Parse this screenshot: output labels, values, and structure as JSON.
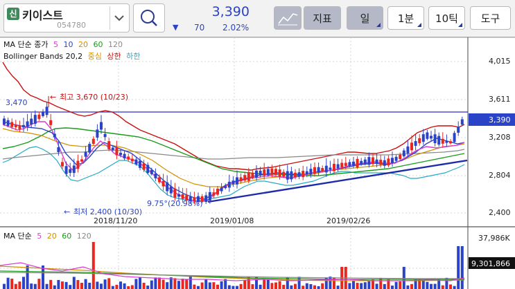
{
  "toolbar": {
    "badge": "신",
    "stock_name": "키이스트",
    "stock_code": "054780",
    "price": "3,390",
    "change_arrow": "▼",
    "change": "70",
    "change_pct": "2.02%",
    "indicator_label": "지표",
    "period_label": "일",
    "minute_label": "1분",
    "tick_label": "10틱",
    "tools_label": "도구"
  },
  "legend": {
    "ma_title": "MA 단순 종가",
    "ma_periods": [
      "5",
      "10",
      "20",
      "60",
      "120"
    ],
    "bb_title": "Bollinger Bands 20,2",
    "bb_items": [
      "중심",
      "상한",
      "하한"
    ],
    "vol_title": "MA 단순",
    "vol_periods": [
      "5",
      "20",
      "60",
      "120"
    ]
  },
  "colors": {
    "up": "#e8281e",
    "down": "#2b43c6",
    "ma5": "#d63cd0",
    "ma10": "#2b43c6",
    "ma20": "#1a9a1a",
    "ma60": "#1a9a1a",
    "ma120": "#888888",
    "bb_mid": "#d19000",
    "bb_upper": "#c80f0f",
    "bb_lower": "#25a9c4"
  },
  "axis": {
    "y_ticks": [
      "4,015",
      "3,611",
      "3,208",
      "2,804",
      "2,400"
    ],
    "x_labels": [
      "2018/11/20",
      "2019/01/08",
      "2019/02/26"
    ],
    "current_price": "3,390",
    "vol_max": "37,986K",
    "vol_current": "9,301,866"
  },
  "annotations": {
    "high_label": "최고 3,670 (10/23)",
    "low_label": "최저 2,400 (10/30)",
    "level_label": "3,470",
    "trend_label": "9.75°(20.98%)"
  }
}
